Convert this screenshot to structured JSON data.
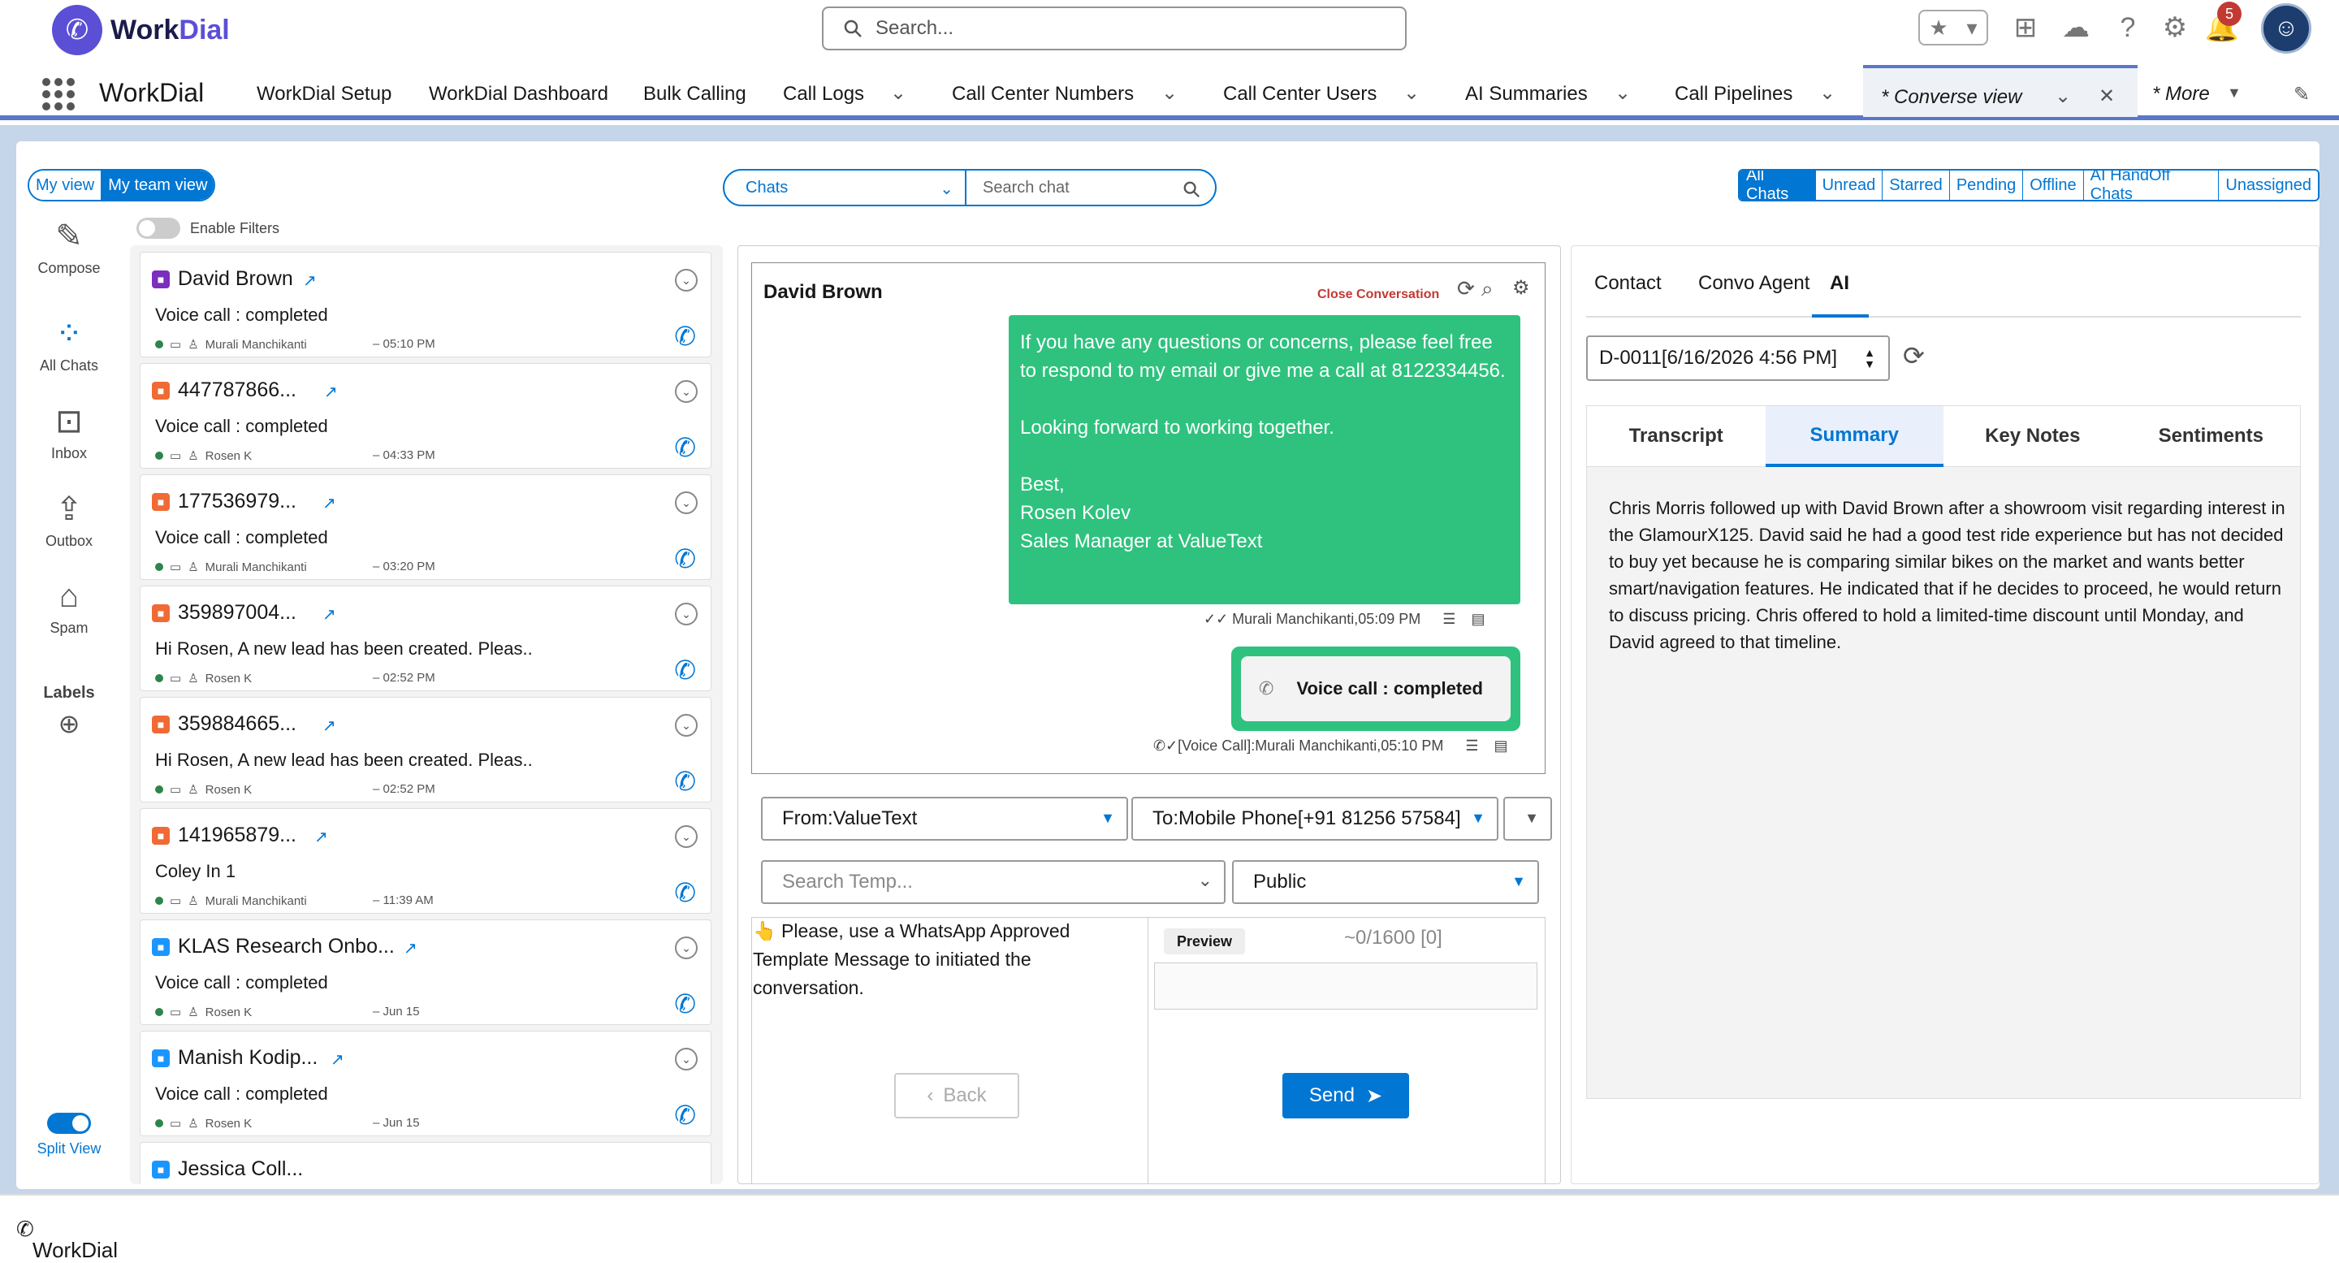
{
  "header": {
    "brand": "WorkDial",
    "search_placeholder": "Search...",
    "notification_count": "5"
  },
  "nav": {
    "app_name": "WorkDial",
    "items": [
      "WorkDial Setup",
      "WorkDial Dashboard",
      "Bulk Calling",
      "Call Logs",
      "Call Center Numbers",
      "Call Center Users",
      "AI Summaries",
      "Call Pipelines"
    ],
    "active_tab": "* Converse view",
    "more": "* More"
  },
  "views": {
    "my_view": "My view",
    "team_view": "My team view"
  },
  "chat_select": "Chats",
  "chat_search_placeholder": "Search chat",
  "filters": {
    "enable_label": "Enable Filters"
  },
  "chat_tabs": [
    "All Chats",
    "Unread",
    "Starred",
    "Pending",
    "Offline",
    "AI HandOff Chats",
    "Unassigned"
  ],
  "rail": {
    "compose": "Compose",
    "all_chats": "All Chats",
    "inbox": "Inbox",
    "outbox": "Outbox",
    "spam": "Spam",
    "labels": "Labels",
    "split_view": "Split View"
  },
  "chats": [
    {
      "name": "David Brown",
      "message": "Voice call : completed",
      "agent": "Murali Manchikanti",
      "time": "– 05:10 PM",
      "badge": "#7b2fbe"
    },
    {
      "name": "447787866...",
      "message": "Voice call : completed",
      "agent": "Rosen K",
      "time": "– 04:33 PM",
      "badge": "#f06a35"
    },
    {
      "name": "177536979...",
      "message": "Voice call : completed",
      "agent": "Murali Manchikanti",
      "time": "– 03:20 PM",
      "badge": "#f06a35"
    },
    {
      "name": "359897004...",
      "message": "Hi Rosen, A new lead has been created. Pleas..",
      "agent": "Rosen K",
      "time": "– 02:52 PM",
      "badge": "#f06a35"
    },
    {
      "name": "359884665...",
      "message": "Hi Rosen, A new lead has been created. Pleas..",
      "agent": "Rosen K",
      "time": "– 02:52 PM",
      "badge": "#f06a35"
    },
    {
      "name": "141965879...",
      "message": "Coley In 1",
      "agent": "Murali Manchikanti",
      "time": "– 11:39 AM",
      "badge": "#f06a35"
    },
    {
      "name": "KLAS Research Onbo...",
      "message": "Voice call : completed",
      "agent": "Rosen K",
      "time": "– Jun 15",
      "badge": "#1b96ff"
    },
    {
      "name": "Manish Kodip...",
      "message": "Voice call : completed",
      "agent": "Rosen K",
      "time": "– Jun 15",
      "badge": "#1b96ff"
    }
  ],
  "partial_chat_name": "Jessica Coll...",
  "conversation": {
    "title": "David Brown",
    "close_label": "Close Conversation",
    "bubble_text": "If you have any questions or concerns, please feel free to respond to my email or give me a call at 8122334456.\n\nLooking forward to working together.\n\nBest,\nRosen Kolev\nSales Manager at ValueText",
    "bubble_meta": "Murali Manchikanti,05:09 PM",
    "voice_call_label": "Voice call : completed",
    "voice_meta": "[Voice Call]:Murali Manchikanti,05:10 PM",
    "from": "From:ValueText",
    "to": "To:Mobile Phone[+91 81256 57584]",
    "template_placeholder": "Search Temp...",
    "visibility": "Public",
    "template_message": "👆 Please, use a WhatsApp Approved Template Message to initiated the conversation.",
    "back_label": "Back",
    "preview_label": "Preview",
    "char_count": "~0/1600 [0]",
    "send_label": "Send"
  },
  "ai_panel": {
    "tabs": [
      "Contact",
      "Convo Agent",
      "AI"
    ],
    "date_select": "D-0011[6/16/2026 4:56 PM]",
    "sub_tabs": [
      "Transcript",
      "Summary",
      "Key Notes",
      "Sentiments"
    ],
    "summary": "Chris Morris followed up with David Brown after a showroom visit regarding interest in the GlamourX125. David said he had a good test ride experience but has not decided to buy yet because he is comparing similar bikes on the market and wants better smart/navigation features. He indicated that if he decides to proceed, he would return to discuss pricing. Chris offered to hold a limited-time discount until Monday, and David agreed to that timeline."
  },
  "footer": {
    "label": "WorkDial"
  }
}
